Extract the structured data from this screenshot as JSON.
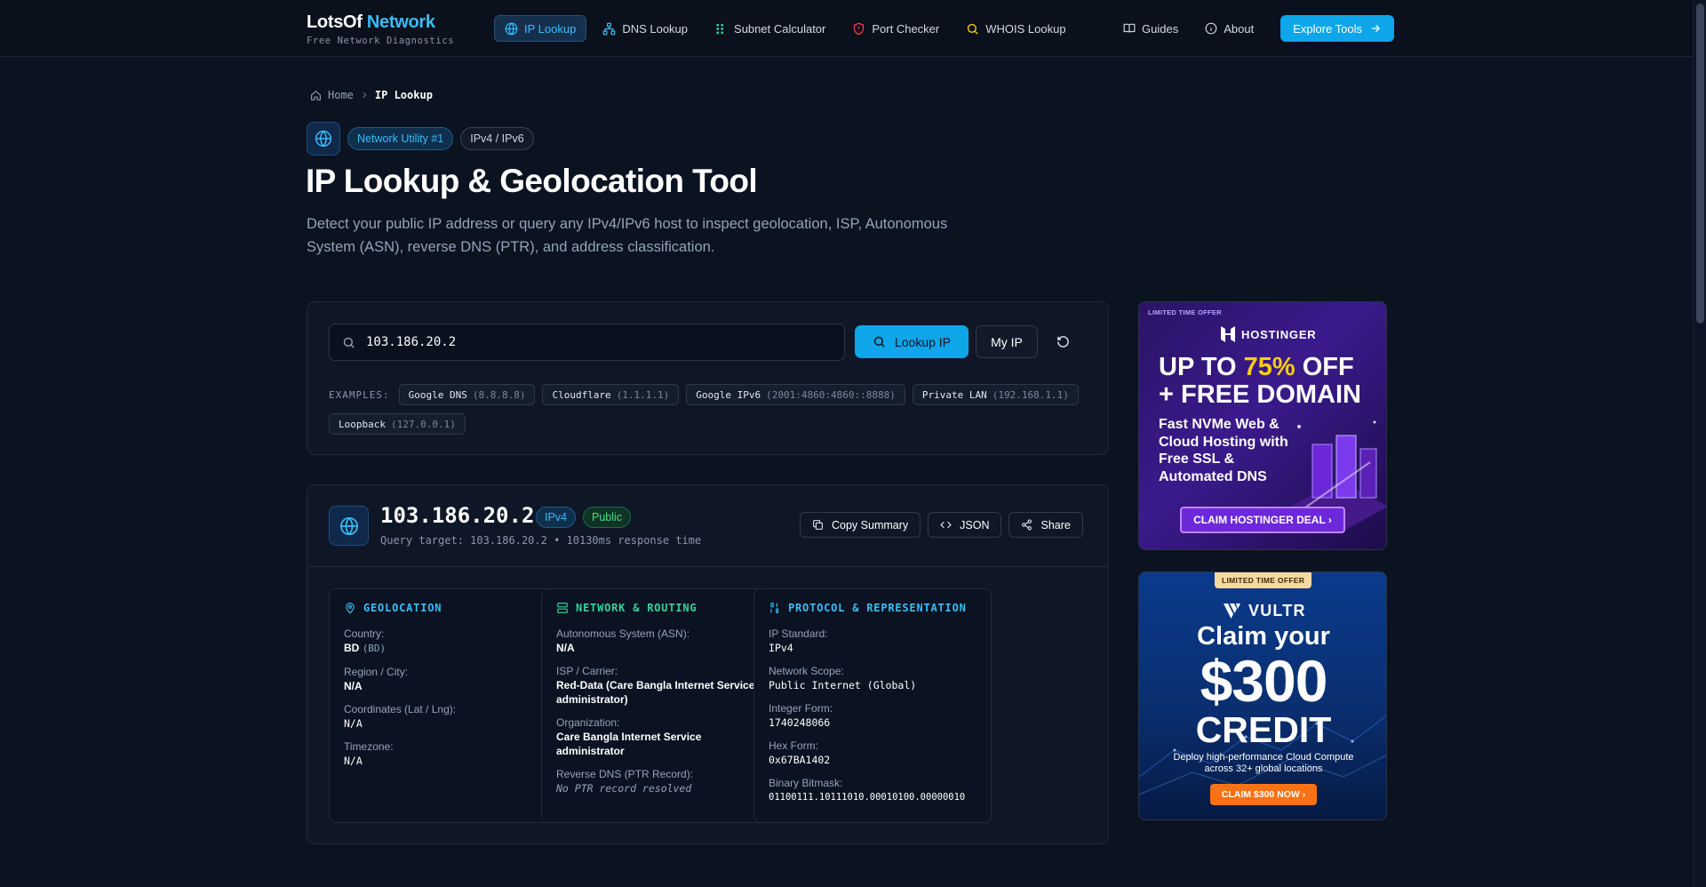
{
  "header": {
    "brand_main": "LotsOf",
    "brand_accent": "Network",
    "brand_sub": "Free Network Diagnostics",
    "nav": [
      {
        "label": "IP Lookup",
        "icon": "globe-icon",
        "active": true
      },
      {
        "label": "DNS Lookup",
        "icon": "network-icon"
      },
      {
        "label": "Subnet Calculator",
        "icon": "grid-icon"
      },
      {
        "label": "Port Checker",
        "icon": "shield-icon"
      },
      {
        "label": "WHOIS Lookup",
        "icon": "search-icon"
      }
    ],
    "guides": "Guides",
    "about": "About",
    "cta": "Explore Tools"
  },
  "breadcrumb": {
    "home": "Home",
    "current": "IP Lookup"
  },
  "hero": {
    "badge_primary": "Network Utility #1",
    "badge_secondary": "IPv4 / IPv6",
    "title": "IP Lookup & Geolocation Tool",
    "description": "Detect your public IP address or query any IPv4/IPv6 host to inspect geolocation, ISP, Autonomous System (ASN), reverse DNS (PTR), and address classification."
  },
  "search": {
    "value": "103.186.20.2",
    "lookup_label": "Lookup IP",
    "myip_label": "My IP",
    "examples_label": "EXAMPLES:",
    "examples": [
      {
        "name": "Google DNS",
        "value": "(8.8.8.8)"
      },
      {
        "name": "Cloudflare",
        "value": "(1.1.1.1)"
      },
      {
        "name": "Google IPv6",
        "value": "(2001:4860:4860::8888)"
      },
      {
        "name": "Private LAN",
        "value": "(192.168.1.1)"
      },
      {
        "name": "Loopback",
        "value": "(127.0.0.1)"
      }
    ]
  },
  "result": {
    "ip": "103.186.20.2",
    "badge_version": "IPv4",
    "badge_scope": "Public",
    "meta": "Query target: 103.186.20.2 • 10130ms response time",
    "actions": {
      "copy": "Copy Summary",
      "json": "JSON",
      "share": "Share"
    },
    "geolocation": {
      "title": "GEOLOCATION",
      "color": "#38bdf8",
      "country_label": "Country:",
      "country_value": "BD",
      "country_code": "(BD)",
      "region_label": "Region / City:",
      "region_value": "N/A",
      "coords_label": "Coordinates (Lat / Lng):",
      "coords_value": "N/A",
      "tz_label": "Timezone:",
      "tz_value": "N/A"
    },
    "network": {
      "title": "NETWORK & ROUTING",
      "color": "#34d399",
      "asn_label": "Autonomous System (ASN):",
      "asn_value": "N/A",
      "isp_label": "ISP / Carrier:",
      "isp_value": "Red-Data (Care Bangla Internet Service administrator)",
      "org_label": "Organization:",
      "org_value": "Care Bangla Internet Service administrator",
      "ptr_label": "Reverse DNS (PTR Record):",
      "ptr_value": "No PTR record resolved"
    },
    "protocol": {
      "title": "PROTOCOL & REPRESENTATION",
      "color": "#38bdf8",
      "std_label": "IP Standard:",
      "std_value": "IPv4",
      "scope_label": "Network Scope:",
      "scope_value": "Public Internet (Global)",
      "int_label": "Integer Form:",
      "int_value": "1740248066",
      "hex_label": "Hex Form:",
      "hex_value": "0x67BA1402",
      "bin_label": "Binary Bitmask:",
      "bin_value": "01100111.10111010.00010100.00000010"
    }
  },
  "ads": {
    "hostinger": {
      "tag": "LIMITED TIME OFFER",
      "brand": "HOSTINGER",
      "line1_a": "UP TO ",
      "line1_b": "75%",
      "line1_c": " OFF",
      "line2": "+ FREE DOMAIN",
      "sub": "Fast NVMe Web & Cloud Hosting with Free SSL & Automated DNS",
      "cta": "CLAIM HOSTINGER DEAL ›"
    },
    "vultr": {
      "tag": "LIMITED TIME OFFER",
      "brand": "VULTR",
      "line1": "Claim your",
      "line2": "$300",
      "line3": "CREDIT",
      "sub": "Deploy high-performance Cloud Compute across 32+ global locations",
      "cta": "CLAIM $300 NOW ›"
    }
  }
}
